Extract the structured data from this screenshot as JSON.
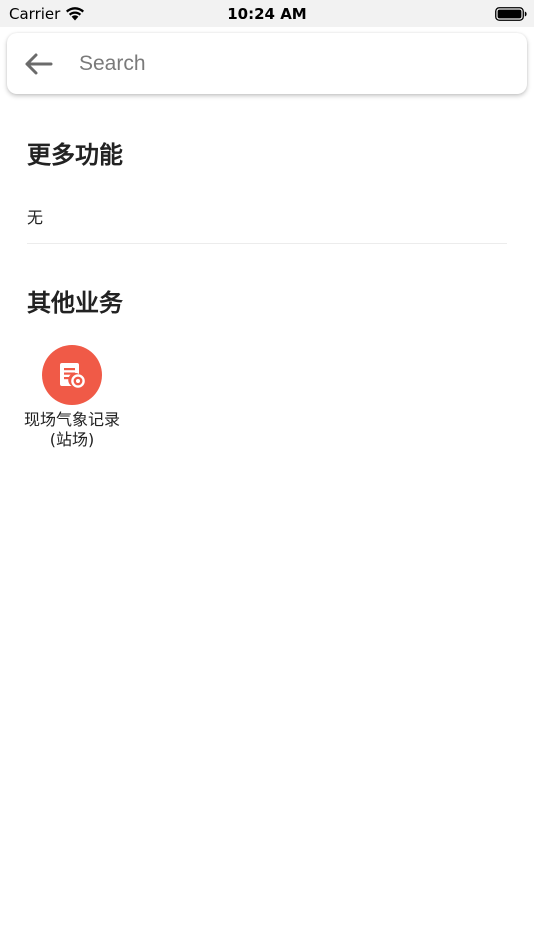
{
  "status_bar": {
    "carrier": "Carrier",
    "time": "10:24 AM",
    "icons": [
      "wifi-icon",
      "battery-icon"
    ]
  },
  "search": {
    "placeholder": "Search",
    "value": "",
    "back_icon": "arrow-left-icon"
  },
  "sections": {
    "more": {
      "title": "更多功能",
      "empty_text": "无"
    },
    "other": {
      "title": "其他业务",
      "items": [
        {
          "label_line1": "现场气象记录",
          "label_line2": "(站场)",
          "icon": "document-record-icon",
          "icon_color": "#f05a47"
        }
      ]
    }
  },
  "colors": {
    "status_bar_bg": "#f2f2f2",
    "accent": "#f05a47",
    "placeholder": "#7a7a7a"
  }
}
